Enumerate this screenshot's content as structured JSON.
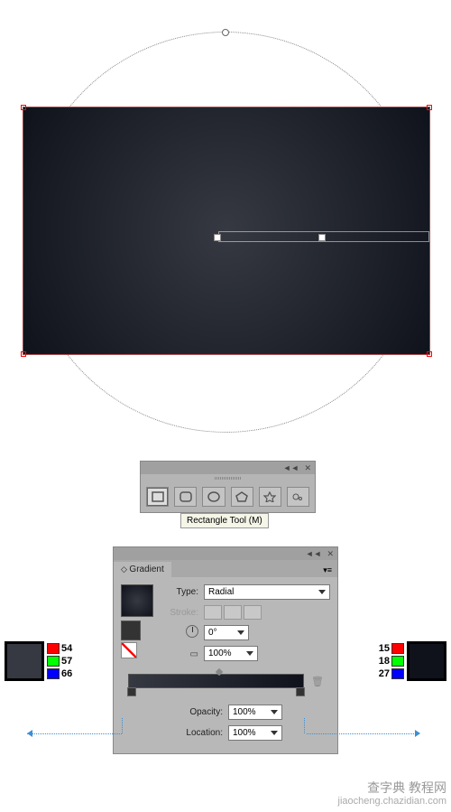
{
  "canvas": {
    "gradient_center_color": "rgb(54,57,66)",
    "gradient_edge_color": "rgb(15,18,27)"
  },
  "tool_palette": {
    "tooltip": "Rectangle Tool (M)"
  },
  "gradient_panel": {
    "title": "Gradient",
    "type_label": "Type:",
    "type_value": "Radial",
    "stroke_label": "Stroke:",
    "angle_value": "0°",
    "aspect_value": "100%",
    "opacity_label": "Opacity:",
    "opacity_value": "100%",
    "location_label": "Location:",
    "location_value": "100%"
  },
  "color_left": {
    "r": "54",
    "g": "57",
    "b": "66"
  },
  "color_right": {
    "r": "15",
    "g": "18",
    "b": "27"
  },
  "watermark": {
    "line1": "查字典 教程网",
    "line2": "jiaocheng.chazidian.com"
  }
}
